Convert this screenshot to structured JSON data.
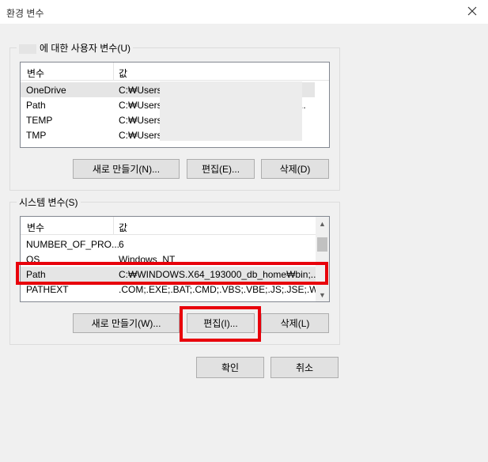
{
  "window": {
    "title": "환경 변수"
  },
  "user_vars": {
    "group_label": "에 대한 사용자 변수(U)",
    "col_name": "변수",
    "col_value": "값",
    "rows": [
      {
        "name": "OneDrive",
        "value": "C:₩Users₩"
      },
      {
        "name": "Path",
        "value": "C:₩Users₩"
      },
      {
        "name": "TEMP",
        "value": "C:₩Users₩"
      },
      {
        "name": "TMP",
        "value": "C:₩Users₩"
      }
    ],
    "path_ellipsis": "..",
    "new_label": "새로 만들기(N)...",
    "edit_label": "편집(E)...",
    "delete_label": "삭제(D)"
  },
  "system_vars": {
    "group_label": "시스템 변수(S)",
    "col_name": "변수",
    "col_value": "값",
    "rows": [
      {
        "name": "NUMBER_OF_PRO...",
        "value": "6"
      },
      {
        "name": "OS",
        "value": "Windows_NT"
      },
      {
        "name": "Path",
        "value": "C:₩WINDOWS.X64_193000_db_home₩bin;..."
      },
      {
        "name": "PATHEXT",
        "value": ".COM;.EXE;.BAT;.CMD;.VBS;.VBE;.JS;.JSE;.W..."
      }
    ],
    "new_label": "새로 만들기(W)...",
    "edit_label": "편집(I)...",
    "delete_label": "삭제(L)"
  },
  "footer": {
    "ok_label": "확인",
    "cancel_label": "취소"
  },
  "colors": {
    "highlight": "#e8000b",
    "selected_row": "#e5e5e5"
  }
}
